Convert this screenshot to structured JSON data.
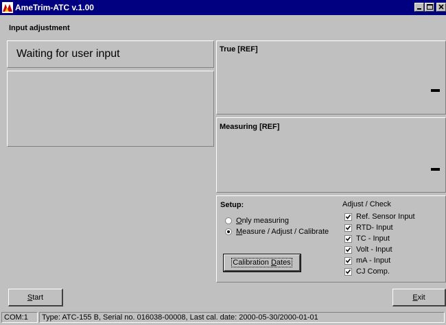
{
  "window": {
    "title": "AmeTrim-ATC v.1.00"
  },
  "header": {
    "section_title": "Input adjustment"
  },
  "status_panel": {
    "message": "Waiting for user input"
  },
  "true_panel": {
    "label": "True [REF]",
    "value": "-"
  },
  "measuring_panel": {
    "label": "Measuring [REF]",
    "value": "-"
  },
  "setup": {
    "title": "Setup:",
    "options": [
      {
        "hotkey": "O",
        "rest": "nly measuring",
        "selected": false
      },
      {
        "hotkey": "M",
        "rest": "easure / Adjust / Calibrate",
        "selected": true
      }
    ],
    "calibration_button": {
      "prefix": "Calibration ",
      "hotkey": "D",
      "rest": "ates"
    }
  },
  "adjust_check": {
    "title": "Adjust / Check",
    "items": [
      {
        "label": "Ref. Sensor Input",
        "checked": true
      },
      {
        "label": "RTD- Input",
        "checked": true
      },
      {
        "label": "TC - Input",
        "checked": true
      },
      {
        "label": "Volt - Input",
        "checked": true
      },
      {
        "label": "mA - Input",
        "checked": true
      },
      {
        "label": "CJ Comp.",
        "checked": true
      }
    ]
  },
  "buttons": {
    "start": {
      "hotkey": "S",
      "rest": "tart"
    },
    "exit": {
      "hotkey": "E",
      "rest": "xit"
    }
  },
  "status_bar": {
    "port": "COM:1",
    "info": "Type: ATC-155 B, Serial no. 016038-00008, Last cal. date: 2000-05-30/2000-01-01"
  },
  "colors": {
    "titlebar": "#000080",
    "face": "#c0c0c0",
    "text": "#000000"
  }
}
